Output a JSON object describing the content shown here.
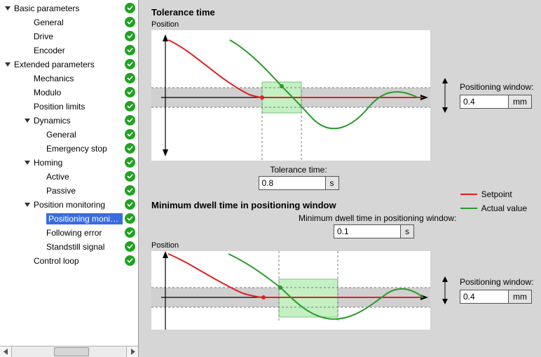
{
  "tree": {
    "items": [
      {
        "label": "Basic parameters",
        "level": 0,
        "expanded": true,
        "has_children": true,
        "check": true
      },
      {
        "label": "General",
        "level": 1,
        "has_children": false,
        "check": true
      },
      {
        "label": "Drive",
        "level": 1,
        "has_children": false,
        "check": true
      },
      {
        "label": "Encoder",
        "level": 1,
        "has_children": false,
        "check": true
      },
      {
        "label": "Extended parameters",
        "level": 0,
        "expanded": true,
        "has_children": true,
        "check": true
      },
      {
        "label": "Mechanics",
        "level": 1,
        "has_children": false,
        "check": true
      },
      {
        "label": "Modulo",
        "level": 1,
        "has_children": false,
        "check": true
      },
      {
        "label": "Position limits",
        "level": 1,
        "has_children": false,
        "check": true
      },
      {
        "label": "Dynamics",
        "level": 1,
        "expanded": true,
        "has_children": true,
        "check": true
      },
      {
        "label": "General",
        "level": 2,
        "has_children": false,
        "check": true
      },
      {
        "label": "Emergency stop",
        "level": 2,
        "has_children": false,
        "check": true
      },
      {
        "label": "Homing",
        "level": 1,
        "expanded": true,
        "has_children": true,
        "check": true
      },
      {
        "label": "Active",
        "level": 2,
        "has_children": false,
        "check": true
      },
      {
        "label": "Passive",
        "level": 2,
        "has_children": false,
        "check": true
      },
      {
        "label": "Position monitoring",
        "level": 1,
        "expanded": true,
        "has_children": true,
        "check": true
      },
      {
        "label": "Positioning monitoring",
        "level": 2,
        "has_children": false,
        "check": true,
        "selected": true
      },
      {
        "label": "Following error",
        "level": 2,
        "has_children": false,
        "check": true
      },
      {
        "label": "Standstill signal",
        "level": 2,
        "has_children": false,
        "check": true
      },
      {
        "label": "Control loop",
        "level": 1,
        "has_children": false,
        "check": true
      }
    ]
  },
  "panel": {
    "section1": {
      "title": "Tolerance time",
      "axis_label": "Position",
      "window_label": "Positioning window:",
      "window_value": "0.4",
      "window_unit": "mm",
      "tol_label": "Tolerance time:",
      "tol_value": "0.8",
      "tol_unit": "s"
    },
    "section2": {
      "title": "Minimum dwell time in positioning window",
      "dwell_label": "Minimum dwell time in positioning window:",
      "dwell_value": "0.1",
      "dwell_unit": "s",
      "axis_label": "Position",
      "window_label": "Positioning window:",
      "window_value": "0.4",
      "window_unit": "mm"
    },
    "legend": {
      "setpoint": "Setpoint",
      "actual": "Actual value"
    },
    "colors": {
      "setpoint": "#e02020",
      "actual": "#2a9a2a",
      "highlight": "#c4f0c4",
      "band": "#d0d0d0"
    }
  }
}
